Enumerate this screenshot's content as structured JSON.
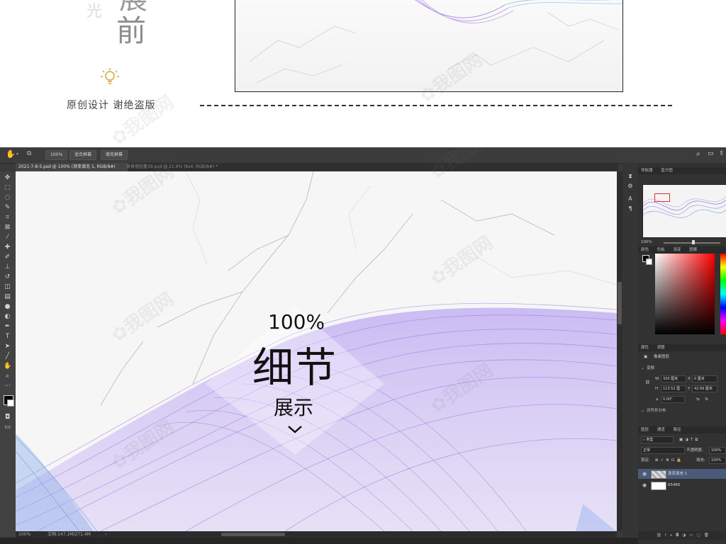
{
  "promo": {
    "vertical_chars": {
      "guang": "光",
      "zhan": "展",
      "qian": "前"
    },
    "original_note": "原创设计  谢绝盗版",
    "bulb_icon": "lightbulb-icon"
  },
  "photoshop": {
    "options_bar": {
      "zoom_value": "100%",
      "fit_screen": "适合屏幕",
      "fill_screen": "填充屏幕"
    },
    "doc_tabs": [
      {
        "label": "2021-7-8-5.psd @ 100% (渐变填充 1, RGB/8#)"
      },
      {
        "label": "背景墙轻奢39.psd @ 21.9% (Ks4, RGB/8#) *"
      }
    ],
    "canvas_overlay": {
      "zoom": "100%",
      "title": "细节",
      "subtitle": "展示"
    },
    "status_bar": {
      "zoom": "100%",
      "doc_info": "文档:147.1M/271.4M"
    },
    "panels": {
      "navigator_tab": "导航器",
      "histogram_tab": "直方图",
      "nav_zoom": "100%",
      "color_tabs": [
        "颜色",
        "色板",
        "渐变",
        "图案"
      ],
      "properties_tabs": [
        "属性",
        "调整"
      ],
      "pixel_layer": "像素图层",
      "transform_title": "变换",
      "w_label": "W",
      "w_value": "320 厘米",
      "x_label": "X",
      "x_value": "0 厘米",
      "h_label": "H",
      "h_value": "113.52 厘",
      "y_label": "Y",
      "y_value": "42.69 厘米",
      "angle_value": "0.00°",
      "align_title": "对齐并分布",
      "layers_tabs": [
        "图层",
        "通道",
        "路径"
      ],
      "filter_kind": "类型",
      "blend_mode": "正常",
      "opacity_label": "不透明度:",
      "opacity_value": "100%",
      "lock_label": "锁定:",
      "fill_label": "填充:",
      "fill_value": "100%",
      "layers": [
        {
          "name": "渐变填充 1"
        },
        {
          "name": "65465"
        }
      ]
    }
  }
}
